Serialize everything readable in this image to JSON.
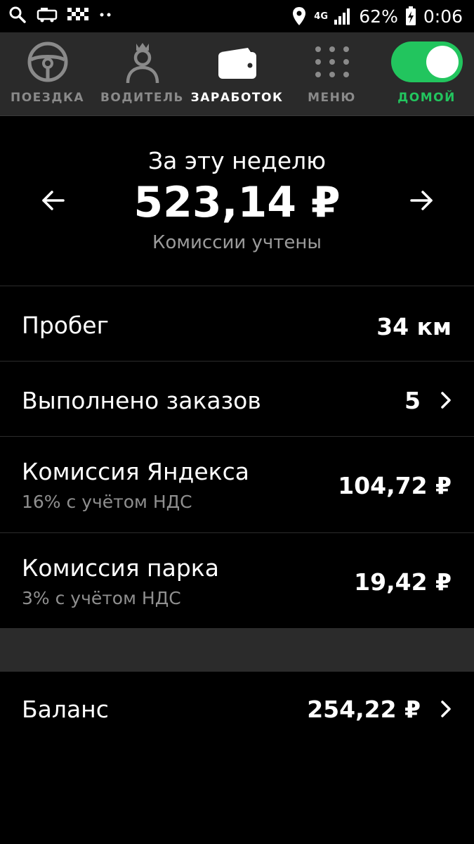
{
  "status_bar": {
    "battery_percent": "62%",
    "time": "0:06",
    "network": "4G"
  },
  "nav": {
    "items": [
      {
        "label": "ПОЕЗДКА",
        "icon": "steering-wheel-icon"
      },
      {
        "label": "ВОДИТЕЛЬ",
        "icon": "driver-crown-icon"
      },
      {
        "label": "ЗАРАБОТОК",
        "icon": "wallet-icon"
      },
      {
        "label": "МЕНЮ",
        "icon": "grid-dots-icon"
      },
      {
        "label": "ДОМОЙ",
        "icon": "toggle-switch"
      }
    ],
    "active_index": 2,
    "home_toggle_on": true,
    "accent_color": "#22c55e"
  },
  "summary": {
    "title": "За эту неделю",
    "total": "523,14 ₽",
    "subtitle": "Комиссии учтены"
  },
  "rows": [
    {
      "title": "Пробег",
      "value": "34 км"
    },
    {
      "title": "Выполнено заказов",
      "value": "5"
    },
    {
      "title": "Комиссия Яндекса",
      "subtitle": "16% с учётом НДС",
      "value": "104,72 ₽"
    },
    {
      "title": "Комиссия парка",
      "subtitle": "3% с учётом НДС",
      "value": "19,42 ₽"
    }
  ],
  "balance": {
    "title": "Баланс",
    "value": "254,22 ₽"
  }
}
